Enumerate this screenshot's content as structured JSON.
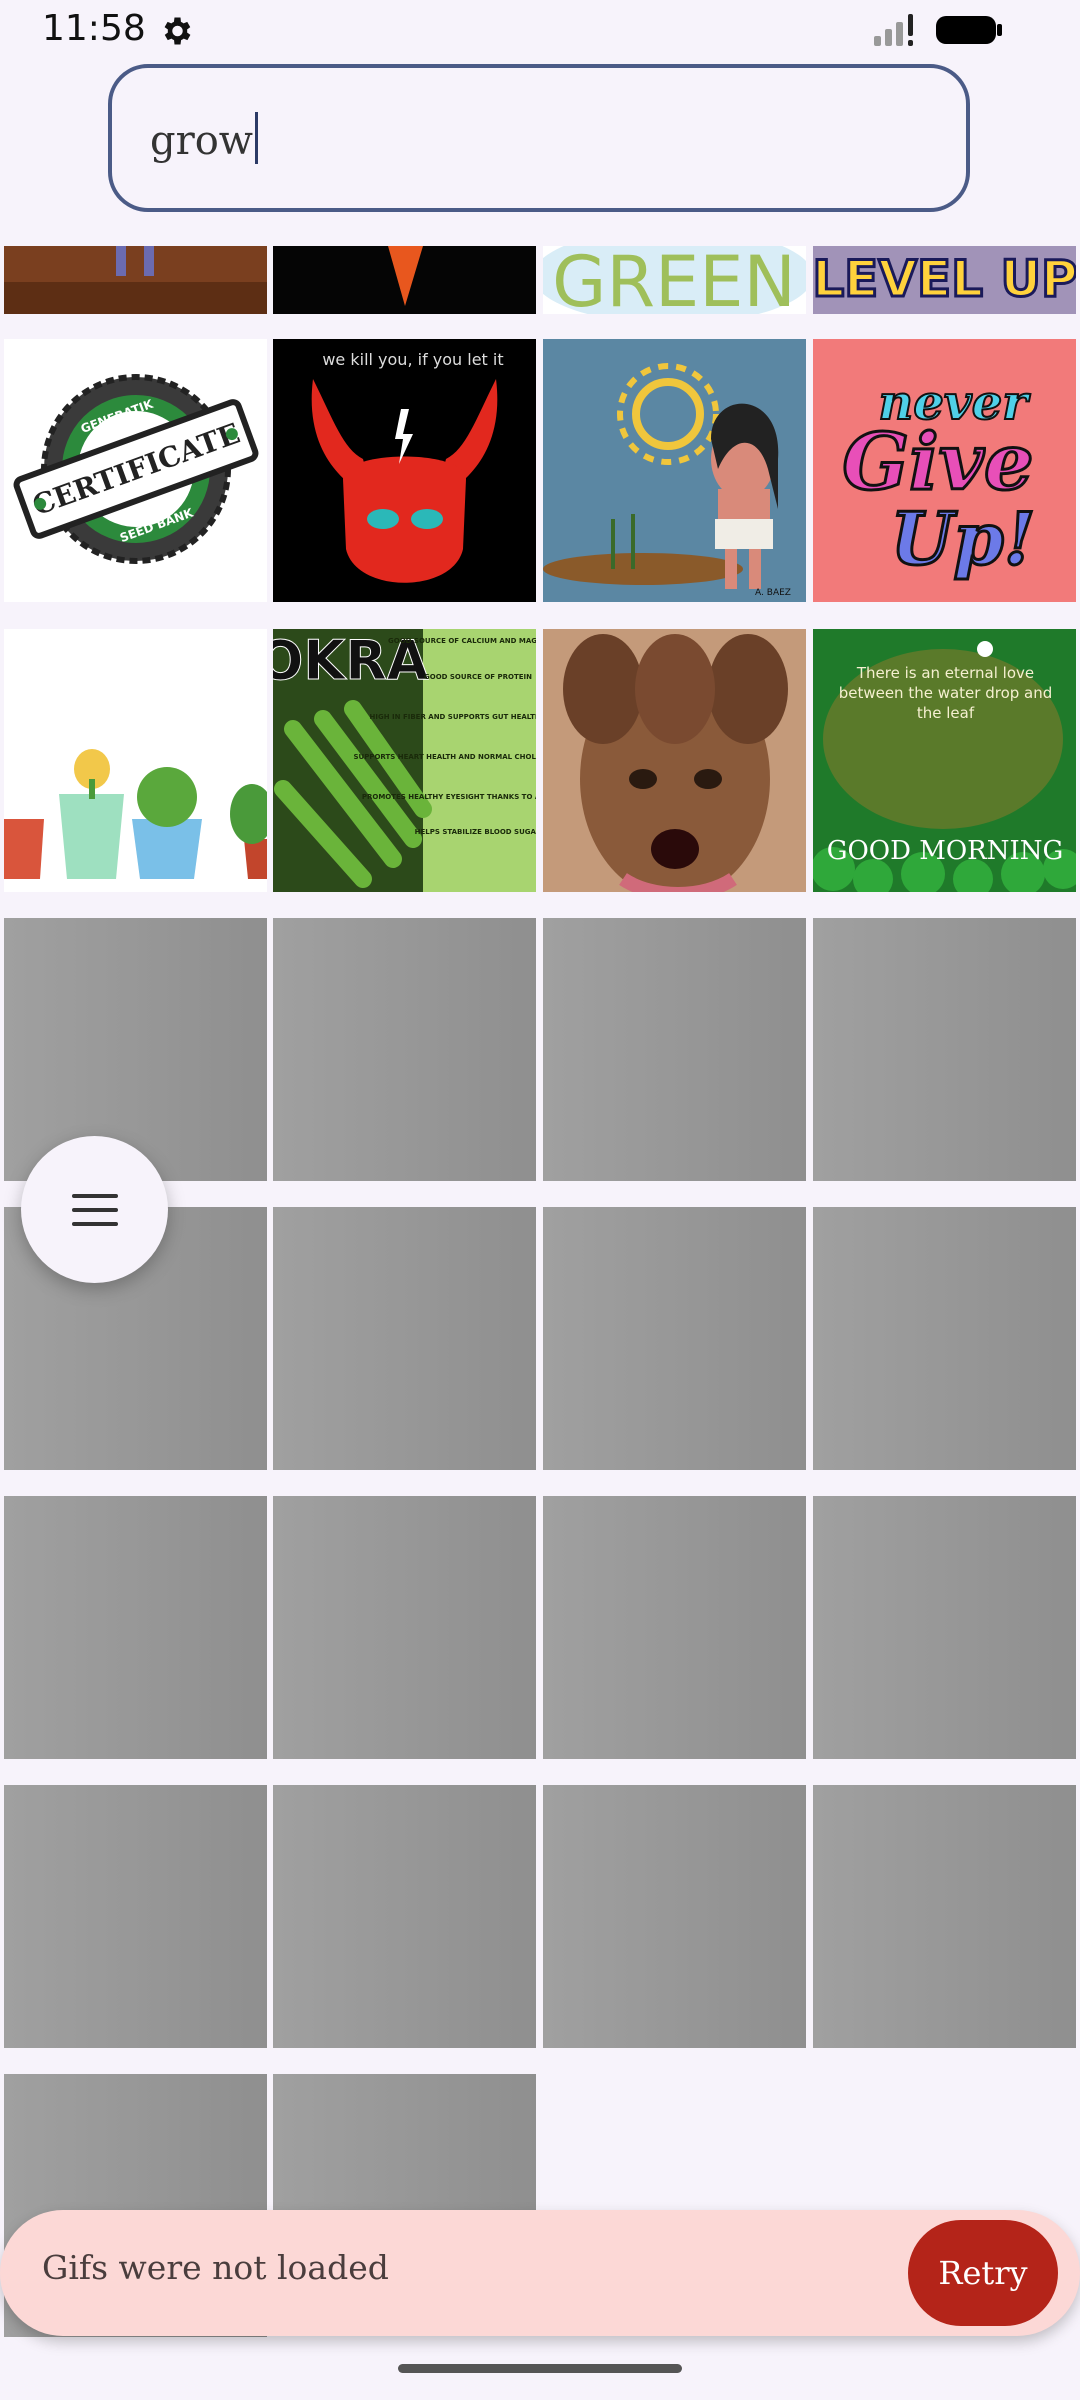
{
  "status_bar": {
    "time": "11:58"
  },
  "search": {
    "query": "grow"
  },
  "gif_grid": {
    "loaded_tile_texts": {
      "green": "GREEN",
      "level_up": "LEVEL UP",
      "certificate_top": "GENERATIK",
      "certificate_main": "CERTIFICATE",
      "certificate_bottom": "SEED BANK",
      "devil_caption": "we kill you, if you let it",
      "sun_signature": "A. BAEZ",
      "never": "never",
      "give": "Give",
      "up": "Up!",
      "okra": "OKRA",
      "okra_facts": [
        "GOOD SOURCE OF CALCIUM AND MAGNESIUM",
        "GOOD SOURCE OF PROTEIN",
        "HIGH IN FIBER AND SUPPORTS GUT HEALTH/DIGESTION",
        "SUPPORTS HEART HEALTH AND NORMAL CHOLESTEROL LEVELS",
        "PROMOTES HEALTHY EYESIGHT THANKS TO ANTIOXIDANTS",
        "HELPS STABILIZE BLOOD SUGAR"
      ],
      "leaf_quote": "There is an eternal love between the water drop and the leaf",
      "good_morning": "GOOD MORNING"
    }
  },
  "menu_fab": {
    "icon": "menu-icon"
  },
  "snackbar": {
    "message": "Gifs were not loaded",
    "action": "Retry"
  }
}
